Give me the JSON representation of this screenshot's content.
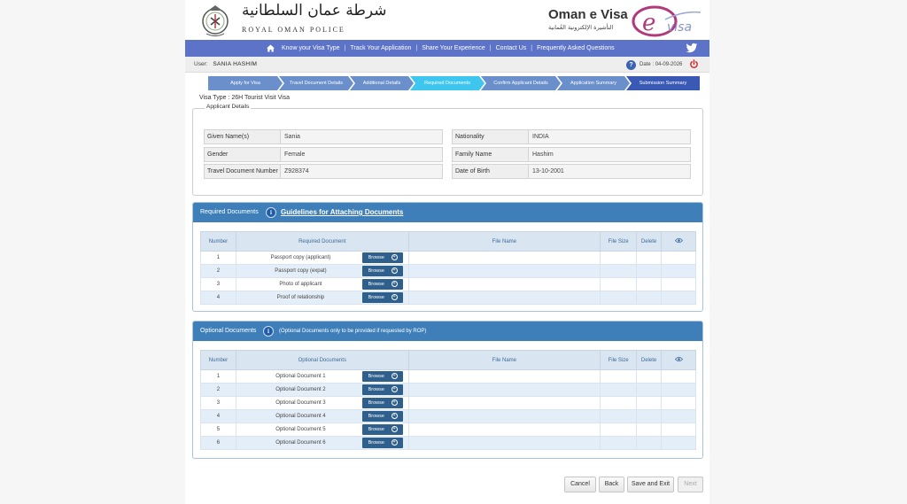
{
  "header": {
    "rop_arabic": "شرطة عمان السلطانية",
    "rop_english": "ROYAL OMAN POLICE",
    "oev_title": "Oman e Visa",
    "oev_arabic": "التأشيرة الإلكترونية العُمانية",
    "oev_logo_text": "e visa"
  },
  "nav": {
    "items": [
      "Know your Visa Type",
      "Track Your Application",
      "Share Your Experience",
      "Contact Us",
      "Frequently Asked Questions"
    ]
  },
  "userbar": {
    "user_label": "User:",
    "user_name": "SANIA  HASHIM",
    "date_label": "Date :",
    "date_value": "04-09-2026"
  },
  "steps": [
    "Apply for Visa",
    "Travel Document Details",
    "Additional Details",
    "Required Documents",
    "Confirm Applicant Details",
    "Application Summary",
    "Submission Summary"
  ],
  "active_step": "Required Documents",
  "visa_type": "Visa Type   : 26H Tourist Visit Visa",
  "applicant": {
    "legend": "Applicant Details",
    "given_name_label": "Given Name(s)",
    "given_name": "Sania",
    "gender_label": "Gender",
    "gender": "Female",
    "travel_doc_label": "Travel Document Number",
    "travel_doc": "Z928374",
    "nationality_label": "Nationality",
    "nationality": "INDIA",
    "family_name_label": "Family Name",
    "family_name": "Hashim",
    "dob_label": "Date of Birth",
    "dob": "13-10-2001"
  },
  "required_docs": {
    "title": "Required Documents",
    "guidelines_link": "Guidelines for Attaching Documents",
    "columns": [
      "Number",
      "Required Document",
      "File Name",
      "File Size",
      "Delete"
    ],
    "rows": [
      {
        "num": "1",
        "name": "Passport copy (applicant)"
      },
      {
        "num": "2",
        "name": "Passport copy (expat)"
      },
      {
        "num": "3",
        "name": "Photo of applicant"
      },
      {
        "num": "4",
        "name": "Proof of relationship"
      }
    ],
    "browse_label": "Browse"
  },
  "optional_docs": {
    "title": "Optional Documents",
    "note": "(Optional Documents only to be provided if requested by ROP)",
    "columns": [
      "Number",
      "Optional Documents",
      "File Name",
      "File Size",
      "Delete"
    ],
    "rows": [
      {
        "num": "1",
        "name": "Optional Document 1"
      },
      {
        "num": "2",
        "name": "Optional Document 2"
      },
      {
        "num": "3",
        "name": "Optional Document 3"
      },
      {
        "num": "4",
        "name": "Optional Document 4"
      },
      {
        "num": "5",
        "name": "Optional Document 5"
      },
      {
        "num": "6",
        "name": "Optional Document 6"
      }
    ],
    "browse_label": "Browse"
  },
  "buttons": {
    "cancel": "Cancel",
    "back": "Back",
    "save_exit": "Save and Exit",
    "next": "Next"
  },
  "colors": {
    "nav_bg": "#5d73c7",
    "step_bg": "#6a8fca",
    "step_active": "#3fc6ef",
    "panel_header": "#3f7fb9",
    "browse_button": "#2f5f8c"
  }
}
